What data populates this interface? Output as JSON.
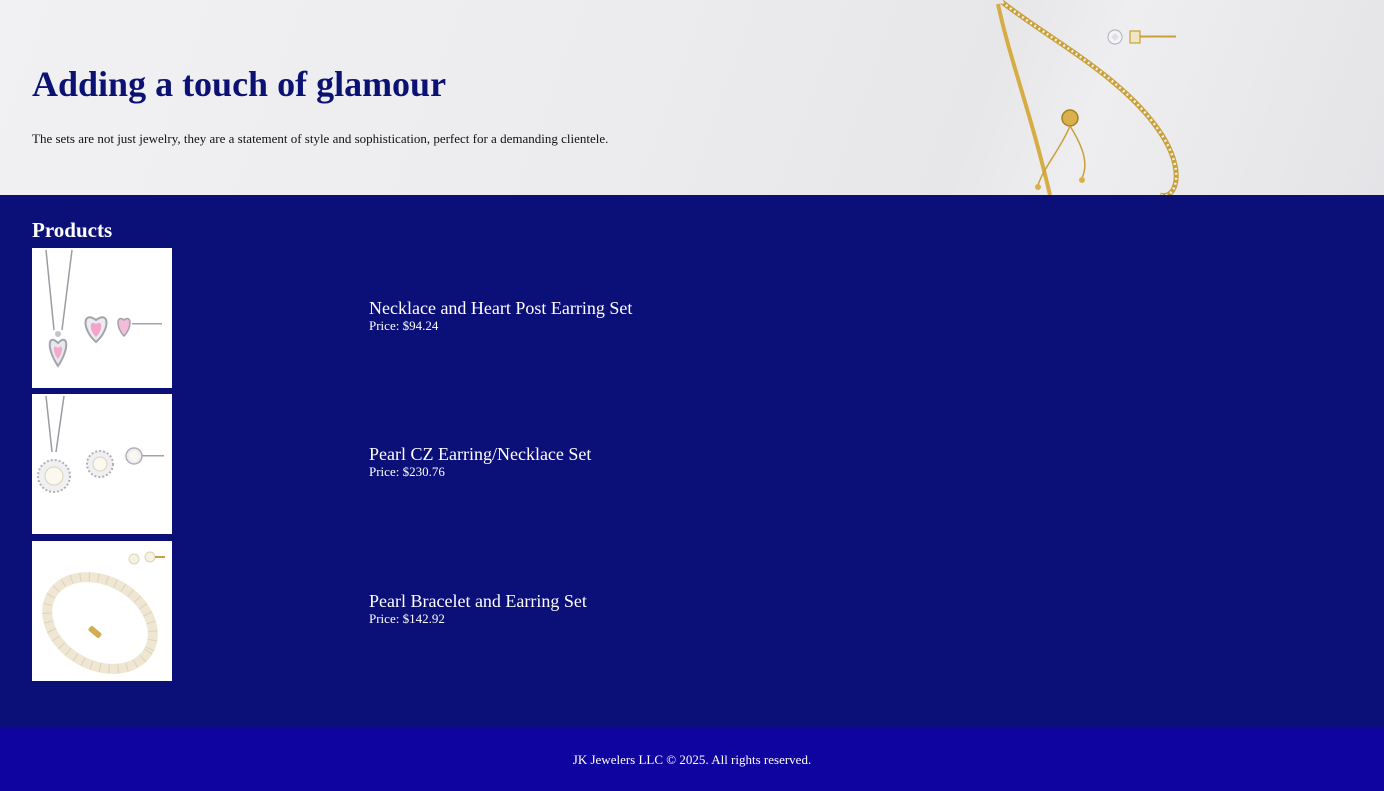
{
  "hero": {
    "title": "Adding a touch of glamour",
    "subtitle": "The sets are not just jewelry, they are a statement of style and sophistication, perfect for a demanding clientele.",
    "image": "gold-bracelet-and-stud-earring-photo"
  },
  "products": {
    "heading": "Products",
    "items": [
      {
        "name": "Necklace and Heart Post Earring Set",
        "price": "Price: $94.24",
        "image": "heart-necklace-earring-photo"
      },
      {
        "name": "Pearl CZ Earring/Necklace Set",
        "price": "Price: $230.76",
        "image": "pearl-necklace-earring-photo"
      },
      {
        "name": "Pearl Bracelet and Earring Set",
        "price": "Price: $142.92",
        "image": "pearl-bracelet-earring-photo"
      }
    ]
  },
  "footer": {
    "text": "JK Jewelers LLC © 2025. All rights reserved."
  },
  "colors": {
    "heading": "#0b1273",
    "main_background": "#0b0f78",
    "footer_background": "#1004a0"
  }
}
